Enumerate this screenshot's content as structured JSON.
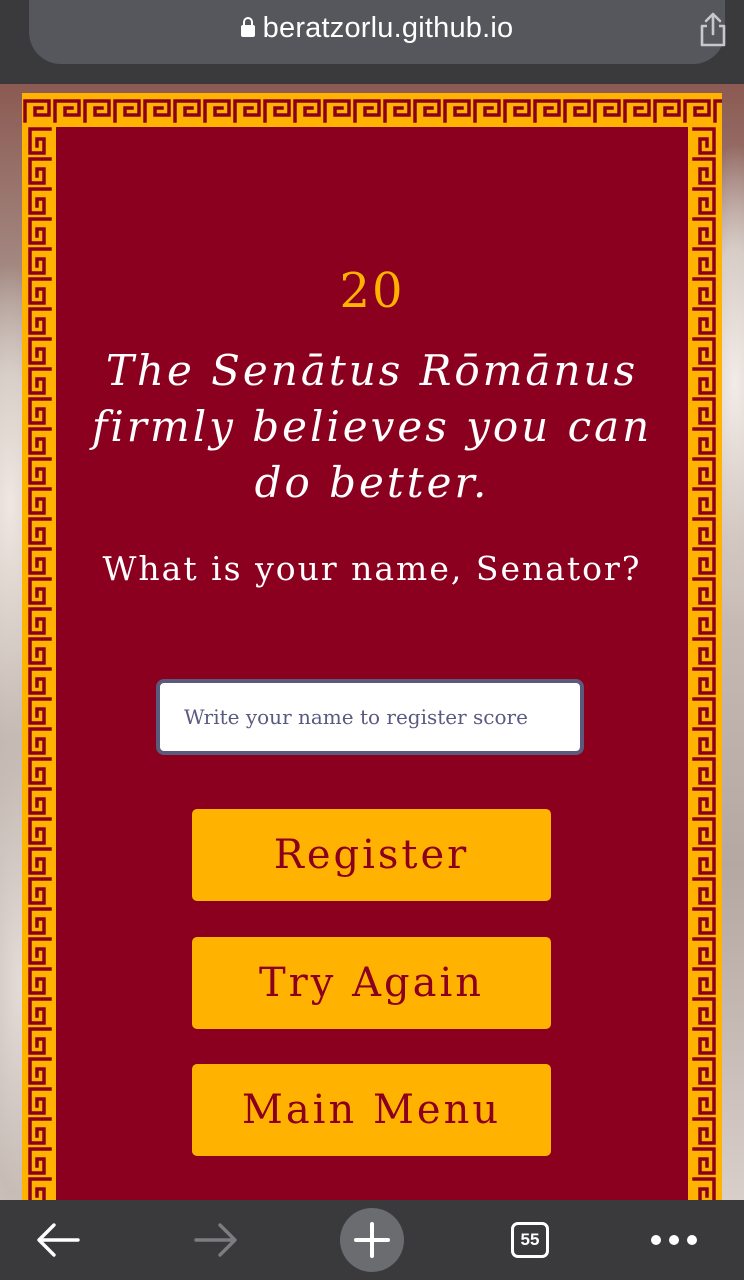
{
  "browser": {
    "url": "beratzorlu.github.io",
    "open_tabs_count": "55"
  },
  "game": {
    "score": "20",
    "message": "The Senātus Rōmānus firmly believes you can do better.",
    "name_prompt": "What is your name, Senator?",
    "name_input": {
      "value": "",
      "placeholder": "Write your name to register score"
    },
    "buttons": {
      "register": "Register",
      "try_again": "Try Again",
      "main_menu": "Main Menu"
    }
  },
  "colors": {
    "panel_red": "#8b001e",
    "gold": "#ffb300",
    "browser_chrome": "#3a3a3c"
  }
}
